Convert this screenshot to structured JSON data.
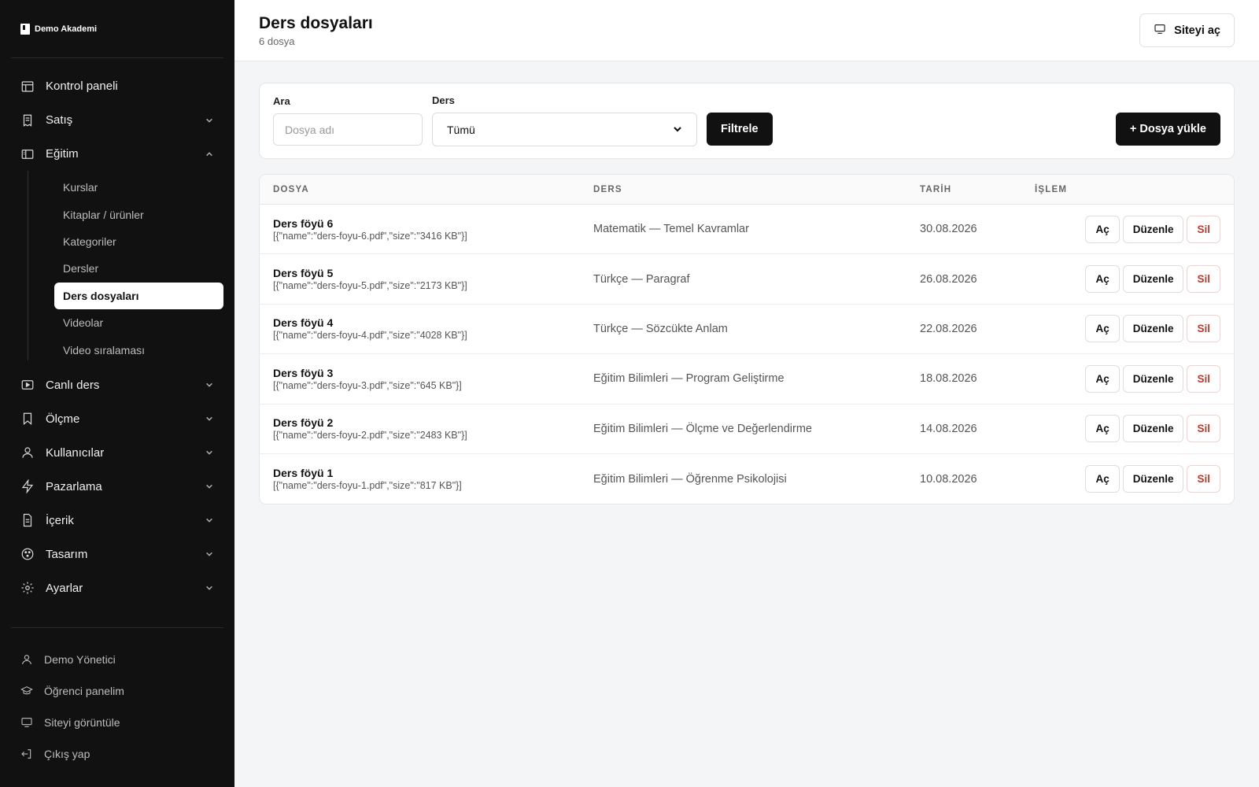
{
  "brand": {
    "name": "Demo Akademi"
  },
  "sidebar": {
    "nav": [
      {
        "label": "Kontrol paneli",
        "icon": "dashboard-icon",
        "chevron": false
      },
      {
        "label": "Satış",
        "icon": "receipt-icon",
        "chevron": true
      }
    ],
    "education": {
      "label": "Eğitim",
      "icon": "book-icon",
      "expanded": true,
      "items": [
        {
          "label": "Kurslar"
        },
        {
          "label": "Kitaplar / ürünler"
        },
        {
          "label": "Kategoriler"
        },
        {
          "label": "Dersler"
        },
        {
          "label": "Ders dosyaları",
          "active": true
        },
        {
          "label": "Videolar"
        },
        {
          "label": "Video sıralaması"
        }
      ]
    },
    "nav_after": [
      {
        "label": "Canlı ders",
        "icon": "video-icon"
      },
      {
        "label": "Ölçme",
        "icon": "bookmark-icon"
      },
      {
        "label": "Kullanıcılar",
        "icon": "user-icon"
      },
      {
        "label": "Pazarlama",
        "icon": "bolt-icon"
      },
      {
        "label": "İçerik",
        "icon": "document-icon"
      },
      {
        "label": "Tasarım",
        "icon": "palette-icon"
      },
      {
        "label": "Ayarlar",
        "icon": "gear-icon"
      }
    ],
    "footer": [
      {
        "label": "Demo Yönetici",
        "icon": "user-icon"
      },
      {
        "label": "Öğrenci panelim",
        "icon": "graduation-cap-icon"
      },
      {
        "label": "Siteyi görüntüle",
        "icon": "monitor-icon"
      },
      {
        "label": "Çıkış yap",
        "icon": "logout-icon"
      }
    ]
  },
  "header": {
    "title": "Ders dosyaları",
    "subtitle": "6 dosya",
    "site_button": "Siteyi aç"
  },
  "filters": {
    "search_label": "Ara",
    "search_placeholder": "Dosya adı",
    "lesson_label": "Ders",
    "lesson_selected": "Tümü",
    "filter_button": "Filtrele",
    "upload_button": "+ Dosya yükle"
  },
  "table": {
    "headers": {
      "file": "DOSYA",
      "lesson": "DERS",
      "date": "TARİH",
      "action": "İŞLEM"
    },
    "action_labels": {
      "open": "Aç",
      "edit": "Düzenle",
      "delete": "Sil"
    },
    "rows": [
      {
        "name": "Ders föyü 6",
        "meta": "[{\"name\":\"ders-foyu-6.pdf\",\"size\":\"3416 KB\"}]",
        "lesson": "Matematik — Temel Kavramlar",
        "date": "30.08.2026"
      },
      {
        "name": "Ders föyü 5",
        "meta": "[{\"name\":\"ders-foyu-5.pdf\",\"size\":\"2173 KB\"}]",
        "lesson": "Türkçe — Paragraf",
        "date": "26.08.2026"
      },
      {
        "name": "Ders föyü 4",
        "meta": "[{\"name\":\"ders-foyu-4.pdf\",\"size\":\"4028 KB\"}]",
        "lesson": "Türkçe — Sözcükte Anlam",
        "date": "22.08.2026"
      },
      {
        "name": "Ders föyü 3",
        "meta": "[{\"name\":\"ders-foyu-3.pdf\",\"size\":\"645 KB\"}]",
        "lesson": "Eğitim Bilimleri — Program Geliştirme",
        "date": "18.08.2026"
      },
      {
        "name": "Ders föyü 2",
        "meta": "[{\"name\":\"ders-foyu-2.pdf\",\"size\":\"2483 KB\"}]",
        "lesson": "Eğitim Bilimleri — Ölçme ve Değerlendirme",
        "date": "14.08.2026"
      },
      {
        "name": "Ders föyü 1",
        "meta": "[{\"name\":\"ders-foyu-1.pdf\",\"size\":\"817 KB\"}]",
        "lesson": "Eğitim Bilimleri — Öğrenme Psikolojisi",
        "date": "10.08.2026"
      }
    ]
  },
  "colors": {
    "sidebar_bg": "#111111",
    "accent": "#111111",
    "danger": "#c0392b",
    "page_bg": "#f4f5f7"
  }
}
